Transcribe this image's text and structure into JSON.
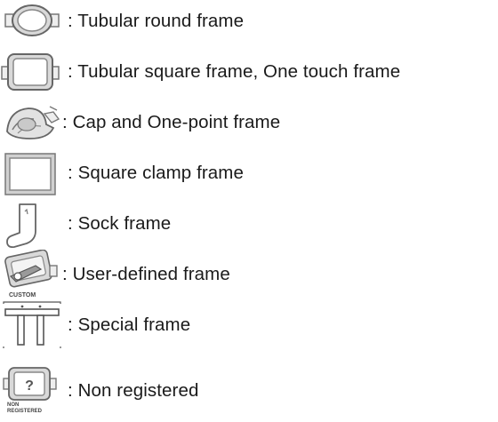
{
  "frames": [
    {
      "icon": "tubular-round-frame-icon",
      "label": ": Tubular round frame"
    },
    {
      "icon": "tubular-square-frame-icon",
      "label": ": Tubular square frame, One touch frame"
    },
    {
      "icon": "cap-frame-icon",
      "label": ": Cap and One-point frame"
    },
    {
      "icon": "square-clamp-frame-icon",
      "label": ": Square clamp frame"
    },
    {
      "icon": "sock-frame-icon",
      "label": ": Sock frame"
    },
    {
      "icon": "user-defined-frame-icon",
      "label": ": User-defined frame",
      "icon_caption": "CUSTOM"
    },
    {
      "icon": "special-frame-icon",
      "label": ": Special frame"
    },
    {
      "icon": "non-registered-frame-icon",
      "label": ": Non registered",
      "icon_caption": "NON REGISTERED"
    }
  ]
}
